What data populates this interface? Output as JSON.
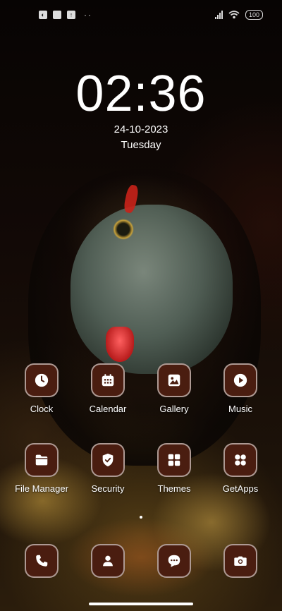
{
  "status_bar": {
    "left_icons": [
      "notification-icon",
      "square-icon",
      "upload-icon"
    ],
    "more": "··",
    "battery": "100"
  },
  "lockscreen": {
    "time": "02:36",
    "date": "24-10-2023",
    "day": "Tuesday"
  },
  "apps": [
    {
      "label": "Clock",
      "icon": "clock-icon"
    },
    {
      "label": "Calendar",
      "icon": "calendar-icon"
    },
    {
      "label": "Gallery",
      "icon": "gallery-icon"
    },
    {
      "label": "Music",
      "icon": "play-icon"
    },
    {
      "label": "File Manager",
      "icon": "folder-icon"
    },
    {
      "label": "Security",
      "icon": "shield-icon"
    },
    {
      "label": "Themes",
      "icon": "grid-icon"
    },
    {
      "label": "GetApps",
      "icon": "apps-icon"
    }
  ],
  "dock": [
    {
      "icon": "phone-icon"
    },
    {
      "icon": "contacts-icon"
    },
    {
      "icon": "messages-icon"
    },
    {
      "icon": "camera-icon"
    }
  ],
  "colors": {
    "tile": "#4a1d10",
    "text": "#ffffff"
  }
}
